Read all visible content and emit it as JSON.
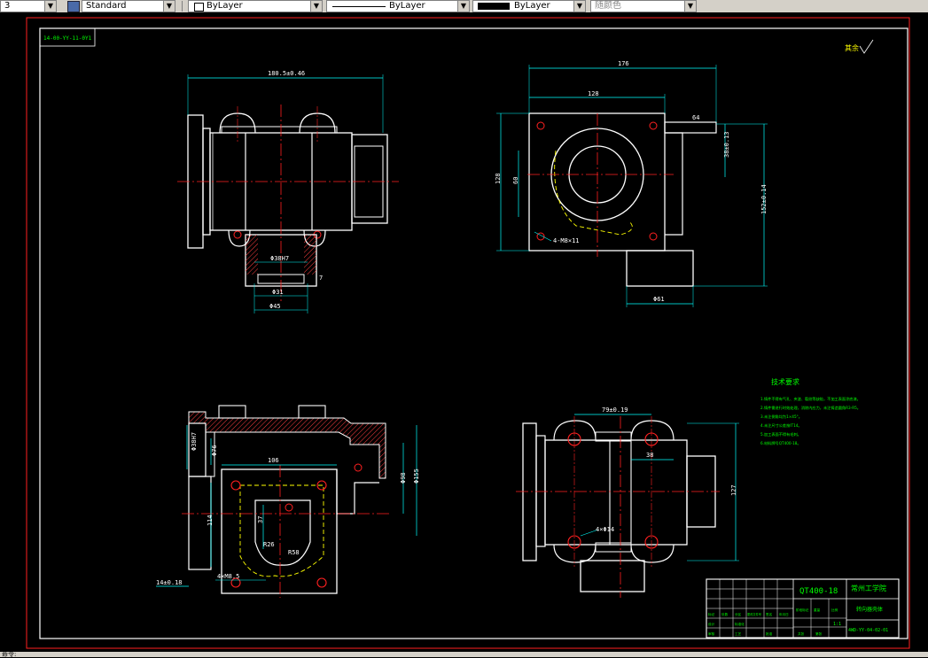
{
  "toolbar": {
    "first_combo": "3",
    "text_style": "Standard",
    "layer": "ByLayer",
    "linetype": "ByLayer",
    "lineweight": "ByLayer",
    "plot_color": "随颜色"
  },
  "drawing": {
    "code_box": "14-00-YY-11-0Y1",
    "roughness_note": "其余",
    "dims_front": {
      "overall": "180.5±0.46",
      "bore": "Φ38H7",
      "outer_bore": "Φ31",
      "base": "Φ45",
      "height": "7"
    },
    "dims_side": {
      "width_top": "176",
      "width_mid": "128",
      "h_left": "128",
      "h_inner": "60",
      "right_a": "38±0.13",
      "right_b": "152±0.14",
      "corner": "64",
      "holes": "4-M8×11",
      "bottom": "Φ61"
    },
    "dims_section": {
      "left_a": "Φ38H7",
      "left_b": "Φ76",
      "width": "106",
      "height_a": "Φ98",
      "height_b": "Φ155",
      "depth": "37",
      "mid": "114",
      "holes": "4×M8.5",
      "bottom_left": "14±0.18",
      "r1": "R26",
      "r2": "R58"
    },
    "dims_top": {
      "span": "79±0.19",
      "mid": "38",
      "holes": "4×Φ14",
      "height": "127"
    },
    "tech_title": "技术要求",
    "tech_notes": [
      "1.铸件不得有气孔、夹渣、裂纹等缺陷，不加工表面涂底漆。",
      "2.铸件需进行时效处理，消除内应力，未注铸造圆角R3-R5。",
      "3.未注倒角均为1×45°。",
      "4.未注尺寸公差按IT14。",
      "5.加工表面不得有毛刺。",
      "6.材料牌号QT400-18。"
    ],
    "title_block": {
      "material": "QT400-18",
      "school": "常州工学院",
      "part_name": "转向器壳体",
      "drawing_no": "4WD-YY-04-02-01",
      "scale": "1:1",
      "row_labels": [
        "标记",
        "处数",
        "分区",
        "更改文件号",
        "签名",
        "年月日"
      ],
      "row2_labels": [
        "设计",
        "标准化",
        "阶段标记",
        "重量",
        "比例"
      ],
      "row3_labels": [
        "审核",
        "工艺",
        "批准",
        "共张",
        "第张"
      ]
    }
  },
  "status": {
    "command": "命令:"
  }
}
